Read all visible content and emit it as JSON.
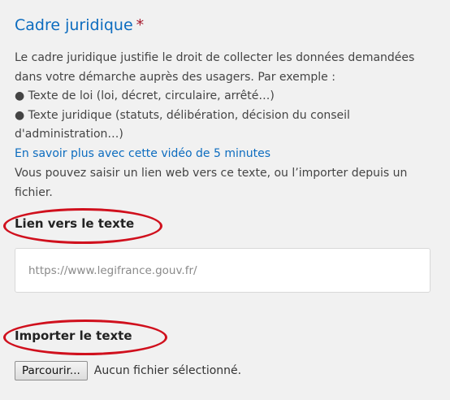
{
  "section": {
    "title": "Cadre juridique",
    "required_mark": "*",
    "description_line1": "Le cadre juridique justifie le droit de collecter les données demandées dans votre démarche auprès des usagers. Par exemple :",
    "bullet1": "● Texte de loi (loi, décret, circulaire, arrêté…)",
    "bullet2": "● Texte juridique (statuts, délibération, décision du conseil d'administration…)",
    "video_link": "En savoir plus avec cette vidéo de 5 minutes",
    "hint": "Vous pouvez saisir un lien web vers ce texte, ou l’importer depuis un fichier."
  },
  "link_field": {
    "label": "Lien vers le texte",
    "value": "",
    "placeholder": "https://www.legifrance.gouv.fr/"
  },
  "import_field": {
    "label": "Importer le texte",
    "browse_label": "Parcourir...",
    "status": "Aucun fichier sélectionné."
  },
  "annotation_color": "#d0101d",
  "accent_color": "#0c6cbf"
}
